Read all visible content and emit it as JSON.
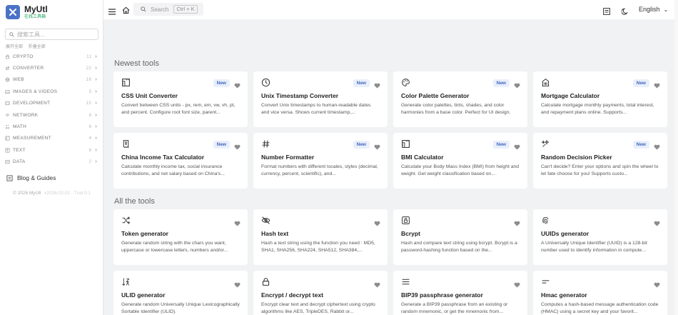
{
  "brand": {
    "title": "MyUtl",
    "subtitle": "在线工具箱"
  },
  "sidebar": {
    "search_placeholder": "搜索工具...",
    "expand_all": "展开全部",
    "collapse_all": "折叠全部",
    "categories": [
      {
        "label": "CRYPTO",
        "count": "11",
        "icon": "lock-icon"
      },
      {
        "label": "CONVERTER",
        "count": "22",
        "icon": "arrows-swap-icon"
      },
      {
        "label": "WEB",
        "count": "16",
        "icon": "globe-icon"
      },
      {
        "label": "IMAGES & VIDEOS",
        "count": "5",
        "icon": "image-icon"
      },
      {
        "label": "DEVELOPMENT",
        "count": "15",
        "icon": "code-icon"
      },
      {
        "label": "NETWORK",
        "count": "6",
        "icon": "wifi-icon"
      },
      {
        "label": "MATH",
        "count": "6",
        "icon": "math-icon"
      },
      {
        "label": "MEASUREMENT",
        "count": "4",
        "icon": "ruler-icon"
      },
      {
        "label": "TEXT",
        "count": "8",
        "icon": "text-icon"
      },
      {
        "label": "DATA",
        "count": "2",
        "icon": "database-icon"
      }
    ],
    "blog_label": "Blog & Guides",
    "copyright": "© 2026 MyUtl",
    "version": "v2026.02.02 · Trial 0.1"
  },
  "header": {
    "search_placeholder": "Search",
    "search_shortcut": "Ctrl + K",
    "language": "English"
  },
  "newest": {
    "title": "Newest tools",
    "badge": "New",
    "tools": [
      {
        "title": "CSS Unit Converter",
        "desc": "Convert between CSS units - px, rem, em, vw, vh, pt, and percent. Configure root font size, parent...",
        "icon": "ruler-icon"
      },
      {
        "title": "Unix Timestamp Converter",
        "desc": "Convert Unix timestamps to human-readable dates and vice versa. Shows current timestamp,...",
        "icon": "clock-icon"
      },
      {
        "title": "Color Palette Generator",
        "desc": "Generate color palettes, tints, shades, and color harmonies from a base color. Perfect for UI design.",
        "icon": "palette-icon"
      },
      {
        "title": "Mortgage Calculator",
        "desc": "Calculate mortgage monthly payments, total interest, and repayment plans online. Supports...",
        "icon": "building-icon"
      },
      {
        "title": "China Income Tax Calculator",
        "desc": "Calculate monthly income tax, social insurance contributions, and net salary based on China's...",
        "icon": "receipt-icon"
      },
      {
        "title": "Number Formatter",
        "desc": "Format numbers with different locales, styles (decimal, currency, percent, scientific), and...",
        "icon": "hash-icon"
      },
      {
        "title": "BMI Calculator",
        "desc": "Calculate your Body Mass Index (BMI) from height and weight. Get weight classification based on...",
        "icon": "ruler-icon"
      },
      {
        "title": "Random Decision Picker",
        "desc": "Can't decide? Enter your options and spin the wheel to let fate choose for you! Supports custo...",
        "icon": "sparkles-icon"
      }
    ]
  },
  "all": {
    "title": "All the tools",
    "tools": [
      {
        "title": "Token generator",
        "desc": "Generate random string with the chars you want, uppercase or lowercase letters, numbers and/or...",
        "icon": "shuffle-icon"
      },
      {
        "title": "Hash text",
        "desc": "Hash a text string using the function you need : MD5, SHA1, SHA256, SHA224, SHA512, SHA384,...",
        "icon": "eye-off-icon"
      },
      {
        "title": "Bcrypt",
        "desc": "Hash and compare text string using bcrypt. Bcrypt is a password-hashing function based on the...",
        "icon": "lock-square-icon"
      },
      {
        "title": "UUIDs generator",
        "desc": "A Universally Unique Identifier (UUID) is a 128-bit number used to identify information in compute...",
        "icon": "fingerprint-icon"
      },
      {
        "title": "ULID generator",
        "desc": "Generate random Universally Unique Lexicographically Sortable Identifier (ULID).",
        "icon": "sort-icon"
      },
      {
        "title": "Encrypt / decrypt text",
        "desc": "Encrypt clear text and decrypt ciphertext using crypto algorithms like AES, TripleDES, Rabbit or...",
        "icon": "lock-icon"
      },
      {
        "title": "BIP39 passphrase generator",
        "desc": "Generate a BIP39 passphrase from an existing or random mnemonic, or get the mnemonic from...",
        "icon": "list-icon"
      },
      {
        "title": "Hmac generator",
        "desc": "Computes a hash-based message authentication code (HMAC) using a secret key and your favorit...",
        "icon": "short-text-icon"
      }
    ]
  }
}
